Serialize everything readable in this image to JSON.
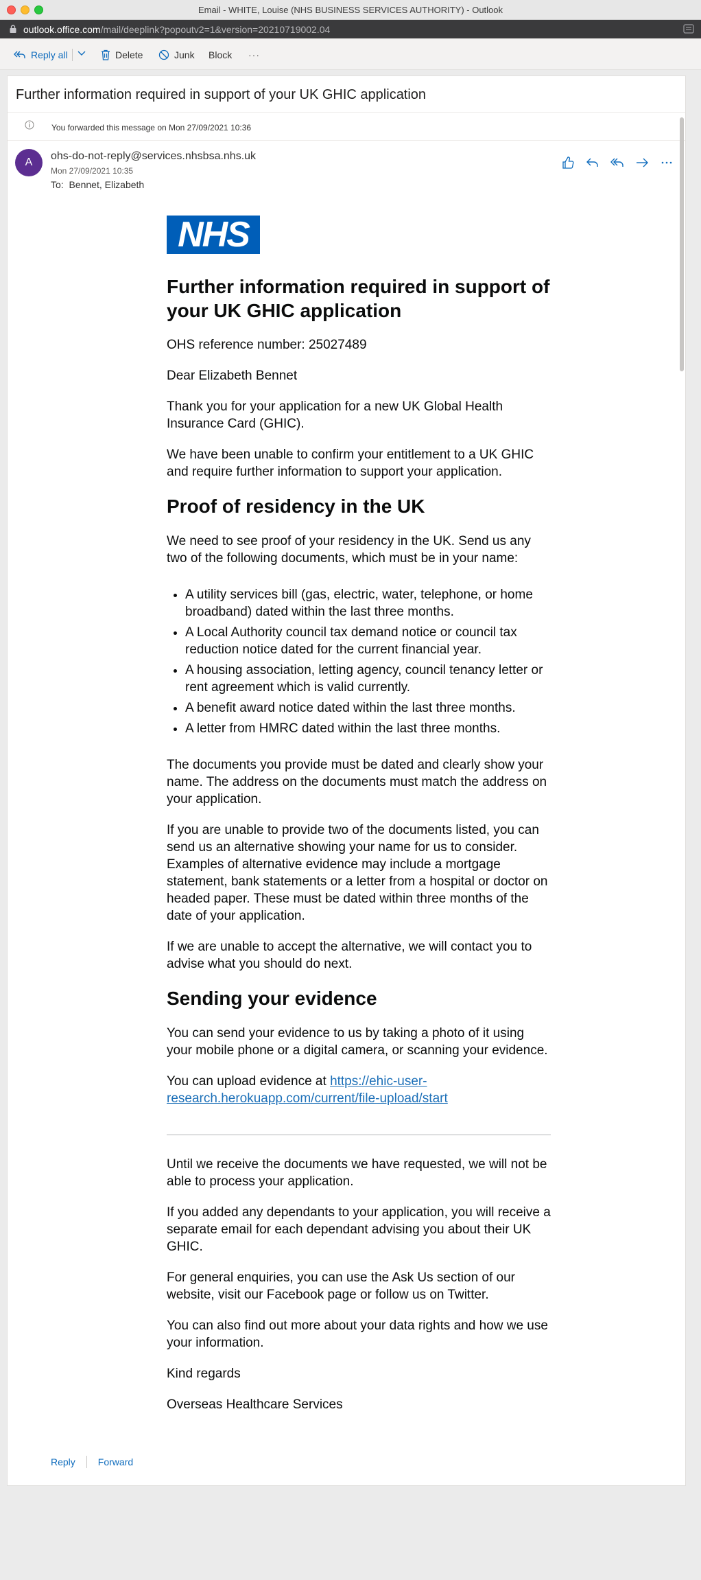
{
  "window": {
    "title": "Email - WHITE, Louise (NHS BUSINESS SERVICES AUTHORITY) - Outlook"
  },
  "browser": {
    "url_host": "outlook.office.com",
    "url_path": "/mail/deeplink?popoutv2=1&version=20210719002.04"
  },
  "toolbar": {
    "reply_all": "Reply all",
    "delete": "Delete",
    "junk": "Junk",
    "block": "Block",
    "more": "···"
  },
  "message": {
    "subject": "Further information required in support of your UK GHIC application",
    "forwarded_notice": "You forwarded this message on Mon 27/09/2021 10:36",
    "avatar_initial": "A",
    "sender": "ohs-do-not-reply@services.nhsbsa.nhs.uk",
    "date": "Mon 27/09/2021 10:35",
    "to_label": "To:",
    "to": "Bennet, Elizabeth"
  },
  "email": {
    "logo": "NHS",
    "heading": "Further information required in support of your UK GHIC application",
    "reference": "OHS reference number: 25027489",
    "greeting": "Dear Elizabeth Bennet",
    "p1": "Thank you for your application for a new UK Global Health Insurance Card (GHIC).",
    "p2": "We have been unable to confirm your entitlement to a UK GHIC and require further information to support your application.",
    "h_residency": "Proof of residency in the UK",
    "p3": "We need to see proof of your residency in the UK. Send us any two of the following documents, which must be in your name:",
    "docs": [
      "A utility services bill (gas, electric, water, telephone, or home broadband) dated within the last three months.",
      "A Local Authority council tax demand notice or council tax reduction notice dated for the current financial year.",
      "A housing association, letting agency, council tenancy letter or rent agreement which is valid currently.",
      "A benefit award notice dated within the last three months.",
      "A letter from HMRC dated within the last three months."
    ],
    "p4": "The documents you provide must be dated and clearly show your name. The address on the documents must match the address on your application.",
    "p5": "If you are unable to provide two of the documents listed, you can send us an alternative showing your name for us to consider. Examples of alternative evidence may include a mortgage statement, bank statements or a letter from a hospital or doctor on headed paper. These must be dated within three months of the date of your application.",
    "p6": "If we are unable to accept the alternative, we will contact you to advise what you should do next.",
    "h_sending": "Sending your evidence",
    "p7": "You can send your evidence to us by taking a photo of it using your mobile phone or a digital camera, or scanning your evidence.",
    "p8_prefix": "You can upload evidence at ",
    "upload_link": "https://ehic-user-research.herokuapp.com/current/file-upload/start",
    "p9": "Until we receive the documents we have requested, we will not be able to process your application.",
    "p10": "If you added any dependants to your application, you will receive a separate email for each dependant advising you about their UK GHIC.",
    "p11": "For general enquiries, you can use the Ask Us section of our website, visit our Facebook page or follow us on Twitter.",
    "p12": "You can also find out more about your data rights and how we use your information.",
    "signoff": "Kind regards",
    "signature": "Overseas Healthcare Services"
  },
  "footer": {
    "reply": "Reply",
    "forward": "Forward"
  },
  "colors": {
    "accent": "#0f6cbd",
    "nhs_blue": "#005eb8",
    "avatar": "#5c2e91",
    "link": "#1d70b8"
  }
}
